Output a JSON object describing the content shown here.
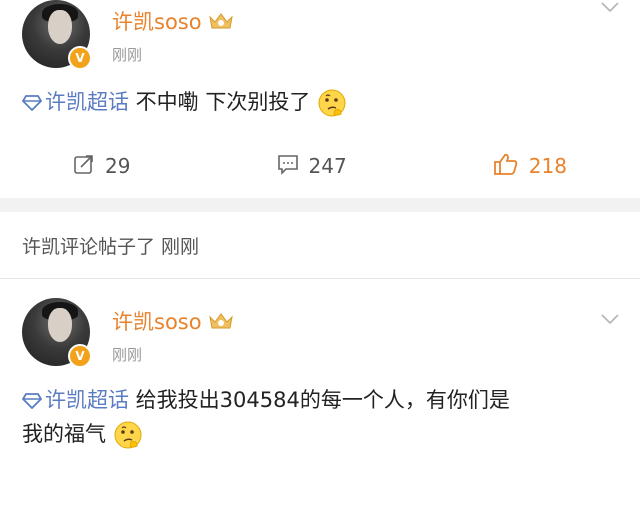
{
  "post1": {
    "author": "许凯soso",
    "time": "刚刚",
    "topic": "许凯超话",
    "text": " 不中嘞 下次别投了",
    "actions": {
      "repost_count": "29",
      "comment_count": "247",
      "like_count": "218"
    },
    "colors": {
      "name": "#e8822b",
      "topic": "#5a7cc2",
      "liked": "#e8822b"
    }
  },
  "notice": {
    "text": "许凯评论帖子了 刚刚"
  },
  "post2": {
    "author": "许凯soso",
    "time": "刚刚",
    "topic": "许凯超话",
    "text_line1": " 给我投出304584的每一个人，有你们是",
    "text_line2": "我的福气"
  },
  "icons": {
    "verified": "v-badge",
    "crown": "crown-badge-icon",
    "repost": "repost-icon",
    "comment": "comment-icon",
    "like": "thumbs-up-icon",
    "menu": "chevron-down-icon",
    "topic": "diamond-icon",
    "emoji": "thinking-face-emoji"
  }
}
